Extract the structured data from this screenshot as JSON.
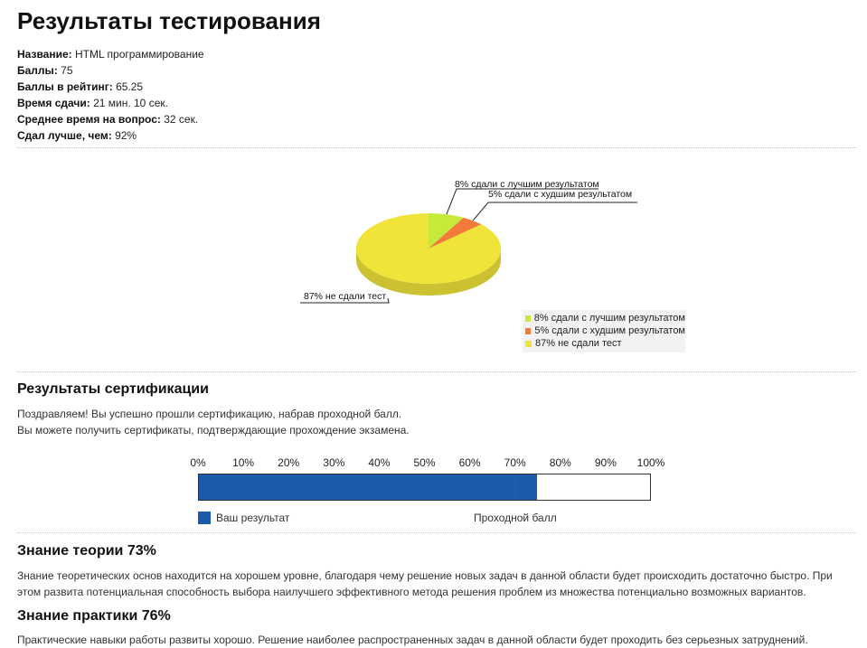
{
  "title": "Результаты тестирования",
  "info": [
    {
      "label": "Название:",
      "value": "HTML программирование"
    },
    {
      "label": "Баллы:",
      "value": "75"
    },
    {
      "label": "Баллы в рейтинг:",
      "value": "65.25"
    },
    {
      "label": "Время сдачи:",
      "value": "21 мин. 10 сек."
    },
    {
      "label": "Среднее время на вопрос:",
      "value": "32 сек."
    },
    {
      "label": "Сдал лучше, чем:",
      "value": "92%"
    }
  ],
  "chart_data": [
    {
      "type": "pie",
      "labels": [
        "8% сдали с лучшим результатом",
        "5% сдали с худшим результатом",
        "87% не сдали тест"
      ],
      "values": [
        8,
        5,
        87
      ],
      "colors": [
        "#c6ea3a",
        "#f27a3b",
        "#f0e33a"
      ],
      "legend": "bottom-right"
    },
    {
      "type": "bar",
      "orientation": "horizontal",
      "categories": [
        "Ваш результат"
      ],
      "values": [
        75
      ],
      "xlim": [
        0,
        100
      ],
      "ticks": [
        "0%",
        "10%",
        "20%",
        "30%",
        "40%",
        "50%",
        "60%",
        "70%",
        "80%",
        "90%",
        "100%"
      ],
      "pass_score": 70,
      "pass_label": "Проходной балл",
      "colors": {
        "result": "#1a5aa8",
        "pass_line": "#b0304a"
      }
    }
  ],
  "cert": {
    "heading": "Результаты сертификации",
    "line1": "Поздравляем! Вы успешно прошли сертификацию, набрав проходной балл.",
    "line2": "Вы можете получить сертификаты, подтверждающие прохождение экзамена."
  },
  "theory": {
    "heading": "Знание теории 73%",
    "text": "Знание теоретических основ находится на хорошем уровне, благодаря чему решение новых задач в данной области будет происходить достаточно быстро. При этом развита потенциальная способность выбора наилучшего эффективного метода решения проблем из множества потенциально возможных вариантов."
  },
  "practice": {
    "heading": "Знание практики 76%",
    "text": "Практические навыки работы развиты хорошо. Решение наиболее распространенных задач в данной области будет проходить без серьезных затруднений."
  }
}
